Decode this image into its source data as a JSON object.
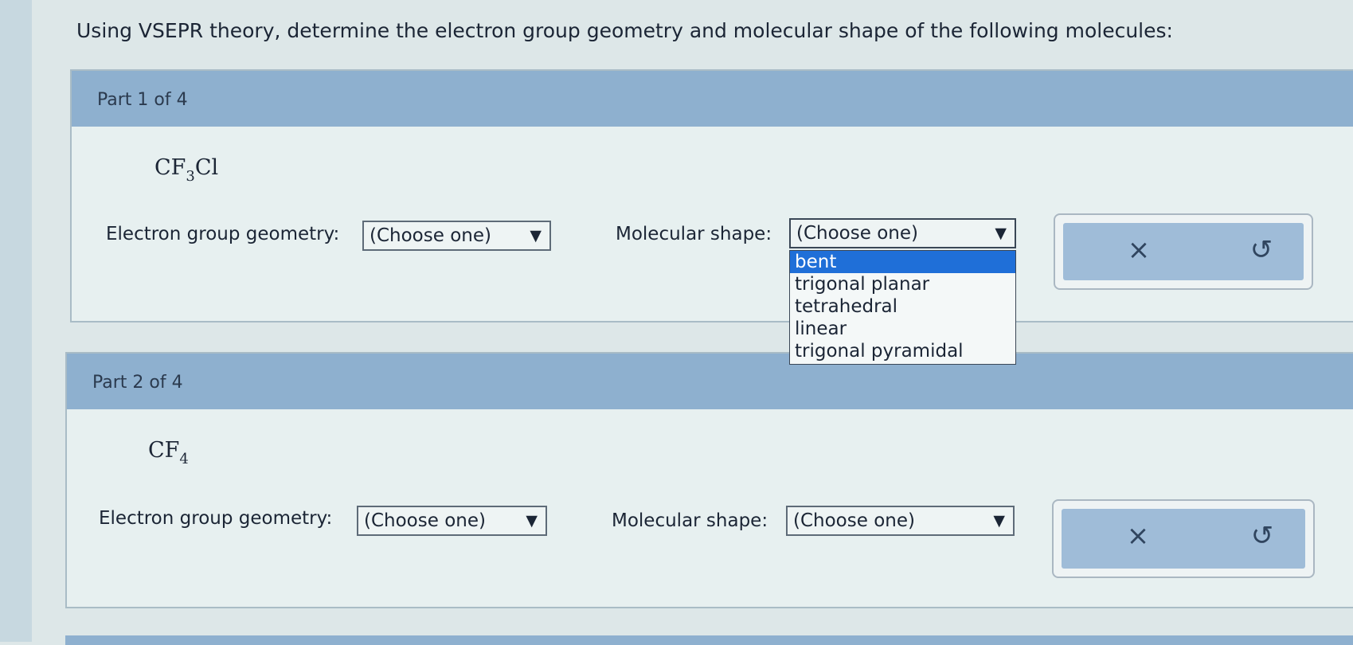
{
  "instructions": "Using VSEPR theory, determine the electron group geometry and molecular shape of the following molecules:",
  "parts": [
    {
      "title": "Part 1 of 4",
      "formula": {
        "main": "CF",
        "sub": "3",
        "tail": "Cl"
      },
      "geometry_label": "Electron group geometry:",
      "geometry_value": "(Choose one)",
      "shape_label": "Molecular shape:",
      "shape_value": "(Choose one)",
      "shape_options": [
        "bent",
        "trigonal planar",
        "tetrahedral",
        "linear",
        "trigonal pyramidal"
      ],
      "highlighted_option": "bent",
      "clear_icon": "×",
      "reset_icon": "↺"
    },
    {
      "title": "Part 2 of 4",
      "formula": {
        "main": "CF",
        "sub": "4",
        "tail": ""
      },
      "geometry_label": "Electron group geometry:",
      "geometry_value": "(Choose one)",
      "shape_label": "Molecular shape:",
      "shape_value": "(Choose one)",
      "clear_icon": "×",
      "reset_icon": "↺"
    }
  ],
  "select_arrow": "▼",
  "colors": {
    "header": "#8eb0cf",
    "panel": "#e7f0f0",
    "highlight": "#1f6fd8",
    "action": "#9fbcd8"
  },
  "icons": {
    "clear": "close-icon",
    "reset": "undo-icon",
    "dropdown": "triangle-down-icon"
  }
}
